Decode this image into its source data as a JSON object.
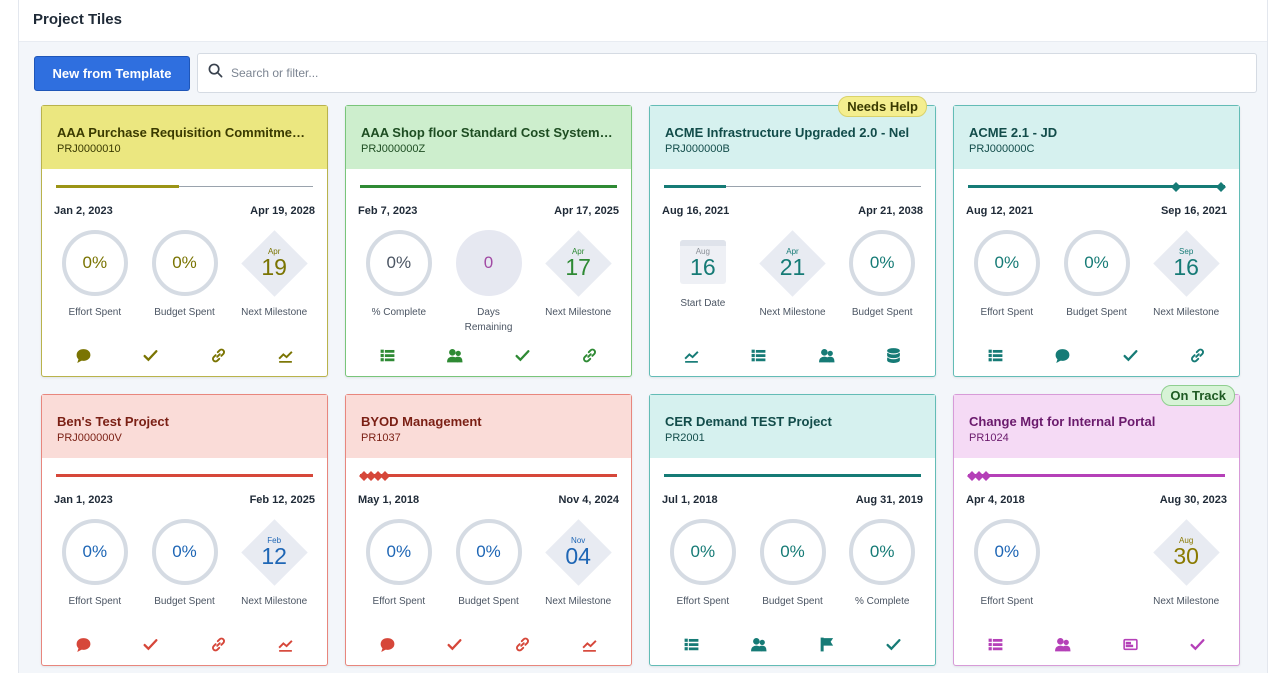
{
  "page": {
    "title": "Project Tiles"
  },
  "toolbar": {
    "new_template_label": "New from Template",
    "search_placeholder": "Search or filter..."
  },
  "tiles": [
    {
      "title": "AAA Purchase Requisition Commitment...",
      "id": "PRJ0000010",
      "start": "Jan 2, 2023",
      "end": "Apr 19, 2028",
      "progress": 0.48,
      "metrics": [
        {
          "value": "0%",
          "label": "Effort Spent"
        },
        {
          "value": "0%",
          "label": "Budget Spent"
        },
        {
          "month": "Apr",
          "day": "19",
          "label": "Next Milestone"
        }
      ],
      "actions": [
        "chat-icon",
        "check-icon",
        "link-icon",
        "trend-icon"
      ]
    },
    {
      "title": "AAA Shop floor Standard Cost System R...",
      "id": "PRJ000000Z",
      "start": "Feb 7, 2023",
      "end": "Apr 17, 2025",
      "progress": 1.0,
      "metrics": [
        {
          "value": "0%",
          "label": "% Complete"
        },
        {
          "value": "0",
          "label": "Days Remaining"
        },
        {
          "month": "Apr",
          "day": "17",
          "label": "Next Milestone"
        }
      ],
      "actions": [
        "list-icon",
        "people-icon",
        "check-icon",
        "link-icon"
      ]
    },
    {
      "badge": "Needs Help",
      "title": "ACME Infrastructure Upgraded 2.0 - Nel",
      "id": "PRJ000000B",
      "start": "Aug 16, 2021",
      "end": "Apr 21, 2038",
      "progress": 0.24,
      "metrics": [
        {
          "month": "Aug",
          "day": "16",
          "label": "Start Date"
        },
        {
          "month": "Apr",
          "day": "21",
          "label": "Next Milestone"
        },
        {
          "value": "0%",
          "label": "Budget Spent"
        }
      ],
      "actions": [
        "trend-icon",
        "list-icon",
        "people-icon",
        "database-icon"
      ]
    },
    {
      "title": "ACME 2.1 - JD",
      "id": "PRJ000000C",
      "start": "Aug 12, 2021",
      "end": "Sep 16, 2021",
      "progress": 1.0,
      "metrics": [
        {
          "value": "0%",
          "label": "Effort Spent"
        },
        {
          "value": "0%",
          "label": "Budget Spent"
        },
        {
          "month": "Sep",
          "day": "16",
          "label": "Next Milestone"
        }
      ],
      "actions": [
        "list-icon",
        "chat-icon",
        "check-icon",
        "link-icon"
      ]
    },
    {
      "title": "Ben's Test Project",
      "id": "PRJ000000V",
      "start": "Jan 1, 2023",
      "end": "Feb 12, 2025",
      "progress": 1.0,
      "metrics": [
        {
          "value": "0%",
          "label": "Effort Spent"
        },
        {
          "value": "0%",
          "label": "Budget Spent"
        },
        {
          "month": "Feb",
          "day": "12",
          "label": "Next Milestone"
        }
      ],
      "actions": [
        "chat-icon",
        "check-icon",
        "link-icon",
        "trend-icon"
      ]
    },
    {
      "title": "BYOD Management",
      "id": "PR1037",
      "start": "May 1, 2018",
      "end": "Nov 4, 2024",
      "progress": 1.0,
      "metrics": [
        {
          "value": "0%",
          "label": "Effort Spent"
        },
        {
          "value": "0%",
          "label": "Budget Spent"
        },
        {
          "month": "Nov",
          "day": "04",
          "label": "Next Milestone"
        }
      ],
      "actions": [
        "chat-icon",
        "check-icon",
        "link-icon",
        "trend-icon"
      ]
    },
    {
      "title": "CER Demand TEST Project",
      "id": "PR2001",
      "start": "Jul 1, 2018",
      "end": "Aug 31, 2019",
      "progress": 1.0,
      "metrics": [
        {
          "value": "0%",
          "label": "Effort Spent"
        },
        {
          "value": "0%",
          "label": "Budget Spent"
        },
        {
          "value": "0%",
          "label": "% Complete"
        }
      ],
      "actions": [
        "list-icon",
        "people-icon",
        "flag-icon",
        "check-icon"
      ]
    },
    {
      "badge": "On Track",
      "title": "Change Mgt for Internal Portal",
      "id": "PR1024",
      "start": "Apr 4, 2018",
      "end": "Aug 30, 2023",
      "progress": 1.0,
      "metrics": [
        {
          "value": "0%",
          "label": "Effort Spent"
        },
        {
          "value": "",
          "label": ""
        },
        {
          "month": "Aug",
          "day": "30",
          "label": "Next Milestone"
        }
      ],
      "actions": [
        "list-icon",
        "people-icon",
        "card-icon",
        "check-icon"
      ]
    }
  ]
}
